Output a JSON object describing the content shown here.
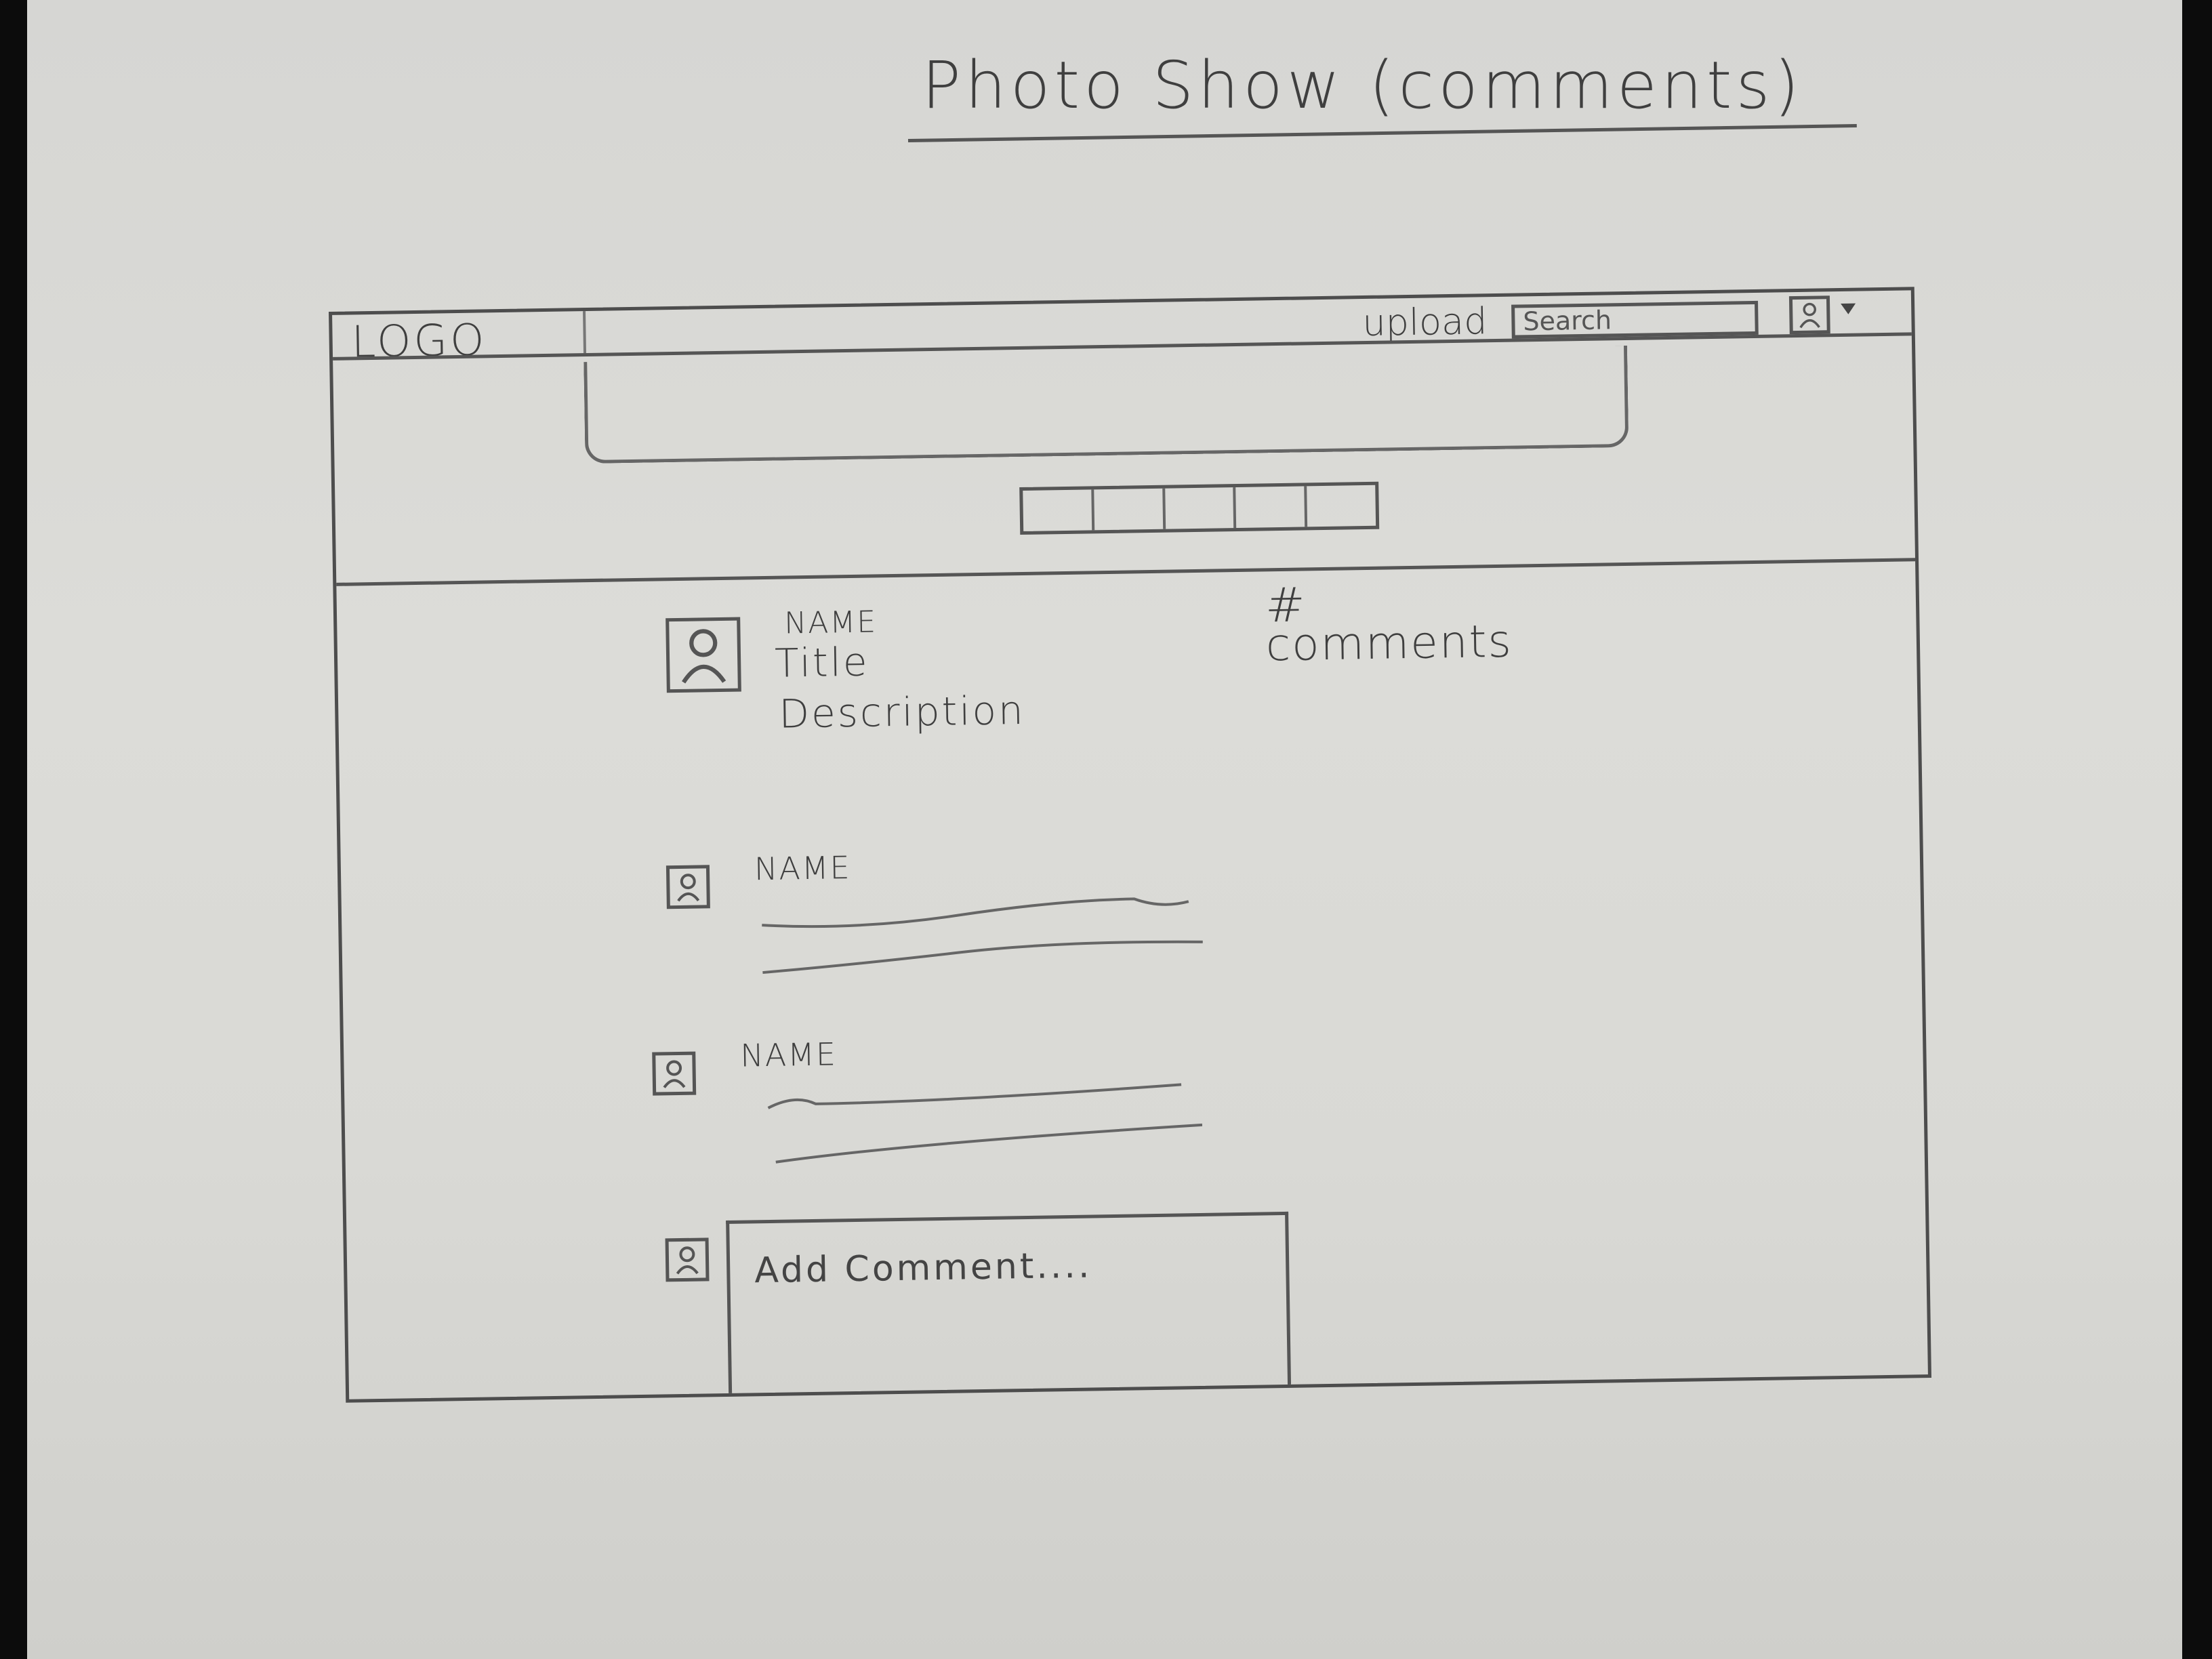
{
  "sheet": {
    "title": "Photo Show (comments)"
  },
  "header": {
    "logo": "LOGO",
    "upload_label": "upload",
    "search_placeholder": "Search",
    "user_menu_icon": "avatar-icon",
    "dropdown_icon": "caret-down-icon"
  },
  "photo": {
    "owner_name": "NAME",
    "title": "Title",
    "description": "Description",
    "comment_count_symbol": "#",
    "comment_count_label": "comments"
  },
  "comments": [
    {
      "name": "NAME"
    },
    {
      "name": "NAME"
    }
  ],
  "composer": {
    "placeholder": "Add Comment...."
  }
}
